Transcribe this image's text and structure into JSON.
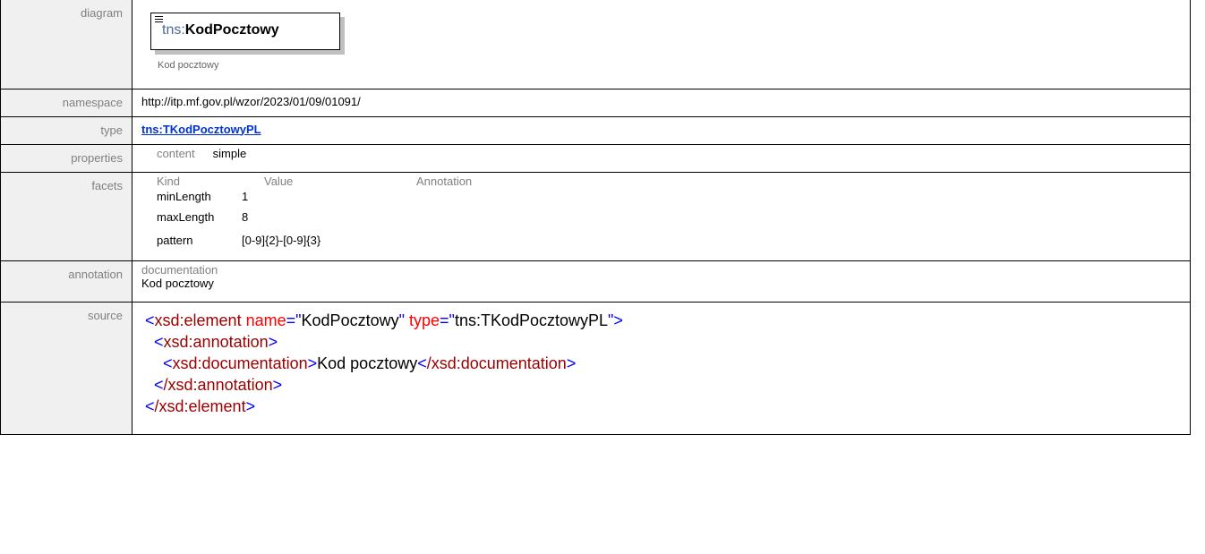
{
  "rows": {
    "diagram": {
      "label": "diagram",
      "prefix": "tns:",
      "name": "KodPocztowy",
      "doc": "Kod pocztowy"
    },
    "namespace": {
      "label": "namespace",
      "value": "http://itp.mf.gov.pl/wzor/2023/01/09/01091/"
    },
    "type": {
      "label": "type",
      "value": "tns:TKodPocztowyPL"
    },
    "properties": {
      "label": "properties",
      "key": "content",
      "value": "simple"
    },
    "facets": {
      "label": "facets",
      "headers": [
        "Kind",
        "Value",
        "Annotation"
      ],
      "items": [
        {
          "kind": "minLength",
          "value": "1"
        },
        {
          "kind": "maxLength",
          "value": "8"
        },
        {
          "kind": "pattern",
          "value": "[0-9]{2}-[0-9]{3}"
        }
      ]
    },
    "annotation": {
      "label": "annotation",
      "key": "documentation",
      "value": "Kod pocztowy"
    },
    "source": {
      "label": "source",
      "l1_tag": "xsd:element",
      "l1_a1": "name",
      "l1_v1": "KodPocztowy",
      "l1_a2": "type",
      "l1_v2": "tns:TKodPocztowyPL",
      "l2_tag": "xsd:annotation",
      "l3_tag": "xsd:documentation",
      "l3_text": "Kod pocztowy",
      "l3_close": "/xsd:documentation",
      "l4_close": "/xsd:annotation",
      "l5_close": "/xsd:element"
    }
  }
}
